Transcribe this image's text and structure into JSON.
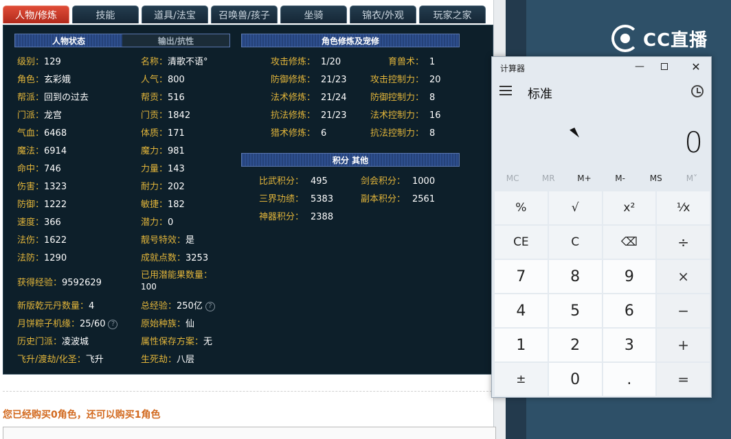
{
  "tabs": [
    "人物/修炼",
    "技能",
    "道具/法宝",
    "召唤兽/孩子",
    "坐骑",
    "锦衣/外观",
    "玩家之家"
  ],
  "active_tab": 0,
  "status_section": {
    "tab_active": "人物状态",
    "tab_inactive": "输出/抗性"
  },
  "left_stats": [
    {
      "k": "级别：",
      "v": "129"
    },
    {
      "k": "角色：",
      "v": "玄彩娥"
    },
    {
      "k": "帮派：",
      "v": "回到の过去"
    },
    {
      "k": "门派：",
      "v": "龙宫"
    },
    {
      "k": "气血：",
      "v": "6468"
    },
    {
      "k": "魔法：",
      "v": "6914"
    },
    {
      "k": "命中：",
      "v": "746"
    },
    {
      "k": "伤害：",
      "v": "1323"
    },
    {
      "k": "防御：",
      "v": "1222"
    },
    {
      "k": "速度：",
      "v": "366"
    },
    {
      "k": "法伤：",
      "v": "1622"
    },
    {
      "k": "法防：",
      "v": "1290"
    }
  ],
  "mid_stats": [
    {
      "k": "名称：",
      "v": "清歌不语°"
    },
    {
      "k": "人气：",
      "v": "800"
    },
    {
      "k": "帮贡：",
      "v": "516"
    },
    {
      "k": "门贡：",
      "v": "1842"
    },
    {
      "k": "体质：",
      "v": "171"
    },
    {
      "k": "魔力：",
      "v": "981"
    },
    {
      "k": "力量：",
      "v": "143"
    },
    {
      "k": "耐力：",
      "v": "202"
    },
    {
      "k": "敏捷：",
      "v": "182"
    },
    {
      "k": "潜力：",
      "v": "0"
    },
    {
      "k": "靓号特效：",
      "v": "是"
    },
    {
      "k": "成就点数：",
      "v": "3253"
    }
  ],
  "extra_stats": {
    "exp": {
      "k": "获得经验：",
      "v": "9592629"
    },
    "potential_fruit": {
      "k": "已用潜能果数量：",
      "v": "100"
    },
    "qianyuan": {
      "k": "新版乾元丹数量：",
      "v": "4"
    },
    "total_exp": {
      "k": "总经验：",
      "v": "250亿"
    },
    "mooncake": {
      "k": "月饼粽子机缘：",
      "v": "25/60"
    },
    "race": {
      "k": "原始种族：",
      "v": "仙"
    },
    "history_school": {
      "k": "历史门派：",
      "v": "凌波城"
    },
    "attr_save": {
      "k": "属性保存方案：",
      "v": "无"
    },
    "ascension": {
      "k": "飞升/渡劫/化圣：",
      "v": "飞升"
    },
    "life_death": {
      "k": "生死劫：",
      "v": "八层"
    }
  },
  "cultivation_title": "角色修炼及宠修",
  "cultivation": [
    {
      "k": "攻击修炼：",
      "v": "1/20",
      "k2": "育兽术：",
      "v2": "1"
    },
    {
      "k": "防御修炼：",
      "v": "21/23",
      "k2": "攻击控制力：",
      "v2": "20"
    },
    {
      "k": "法术修炼：",
      "v": "21/24",
      "k2": "防御控制力：",
      "v2": "8"
    },
    {
      "k": "抗法修炼：",
      "v": "21/23",
      "k2": "法术控制力：",
      "v2": "16"
    },
    {
      "k": "猎术修炼：",
      "v": "6",
      "k2": "抗法控制力：",
      "v2": "8"
    }
  ],
  "points_title": "积分 其他",
  "points": [
    {
      "k": "比武积分：",
      "v": "495",
      "k2": "剑会积分：",
      "v2": "1000"
    },
    {
      "k": "三界功绩：",
      "v": "5383",
      "k2": "副本积分：",
      "v2": "2561"
    },
    {
      "k": "神器积分：",
      "v": "2388",
      "k2": "",
      "v2": ""
    }
  ],
  "purchase_note": "您已经购买0角色，还可以购买1角色",
  "logo_text": "CC直播",
  "calculator": {
    "title": "计算器",
    "mode": "标准",
    "display": "0",
    "memory": [
      {
        "label": "MC",
        "enabled": false
      },
      {
        "label": "MR",
        "enabled": false
      },
      {
        "label": "M+",
        "enabled": true
      },
      {
        "label": "M-",
        "enabled": true
      },
      {
        "label": "MS",
        "enabled": true
      },
      {
        "label": "M˅",
        "enabled": false
      }
    ],
    "keys": [
      {
        "label": "%",
        "kind": "fn",
        "name": "percent-key"
      },
      {
        "label": "√",
        "kind": "fn",
        "name": "sqrt-key"
      },
      {
        "label": "x²",
        "kind": "fn",
        "name": "square-key"
      },
      {
        "label": "¹⁄x",
        "kind": "fn",
        "name": "reciprocal-key"
      },
      {
        "label": "CE",
        "kind": "fn",
        "name": "clear-entry-key"
      },
      {
        "label": "C",
        "kind": "fn",
        "name": "clear-key"
      },
      {
        "label": "⌫",
        "kind": "fn",
        "name": "backspace-key"
      },
      {
        "label": "÷",
        "kind": "op",
        "name": "divide-key"
      },
      {
        "label": "7",
        "kind": "num",
        "name": "digit-7-key"
      },
      {
        "label": "8",
        "kind": "num",
        "name": "digit-8-key"
      },
      {
        "label": "9",
        "kind": "num",
        "name": "digit-9-key"
      },
      {
        "label": "×",
        "kind": "op",
        "name": "multiply-key"
      },
      {
        "label": "4",
        "kind": "num",
        "name": "digit-4-key"
      },
      {
        "label": "5",
        "kind": "num",
        "name": "digit-5-key"
      },
      {
        "label": "6",
        "kind": "num",
        "name": "digit-6-key"
      },
      {
        "label": "−",
        "kind": "op",
        "name": "subtract-key"
      },
      {
        "label": "1",
        "kind": "num",
        "name": "digit-1-key"
      },
      {
        "label": "2",
        "kind": "num",
        "name": "digit-2-key"
      },
      {
        "label": "3",
        "kind": "num",
        "name": "digit-3-key"
      },
      {
        "label": "+",
        "kind": "op",
        "name": "add-key"
      },
      {
        "label": "±",
        "kind": "fn",
        "name": "negate-key"
      },
      {
        "label": "0",
        "kind": "num",
        "name": "digit-0-key"
      },
      {
        "label": ".",
        "kind": "num",
        "name": "decimal-key"
      },
      {
        "label": "=",
        "kind": "op",
        "name": "equals-key"
      }
    ]
  },
  "colors": {
    "tab_active": "#c23a28",
    "panel_bg": "#0d1f2a",
    "stat_key": "#e2b53a",
    "note": "#d2691e"
  }
}
